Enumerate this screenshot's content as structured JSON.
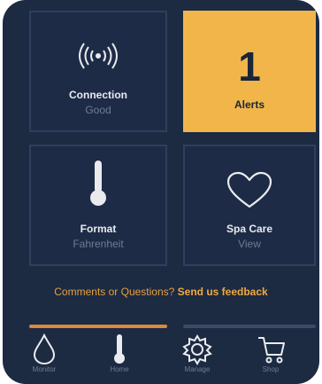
{
  "tiles": {
    "connection": {
      "title": "Connection",
      "status": "Good",
      "icon": "wifi-broadcast-icon"
    },
    "alerts": {
      "count": "1",
      "title": "Alerts"
    },
    "format": {
      "title": "Format",
      "value": "Fahrenheit",
      "icon": "thermometer-icon"
    },
    "spa_care": {
      "title": "Spa Care",
      "value": "View",
      "icon": "heart-icon"
    }
  },
  "feedback": {
    "prefix": "Comments or Questions?",
    "link": "Send us feedback"
  },
  "nav": {
    "items": [
      {
        "label": "Monitor",
        "icon": "water-drop-icon"
      },
      {
        "label": "Home",
        "icon": "thermometer-icon"
      },
      {
        "label": "Manage",
        "icon": "gear-icon"
      },
      {
        "label": "Shop",
        "icon": "cart-icon"
      }
    ]
  },
  "colors": {
    "background": "#1c2a42",
    "accent": "#f1b54a",
    "link": "#f0a93f"
  }
}
